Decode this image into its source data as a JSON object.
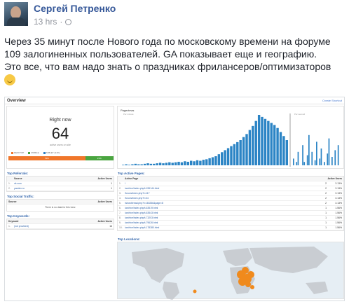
{
  "post": {
    "author": "Сергей Петренко",
    "time": "13 hrs",
    "lines": [
      "Через 35 минут после Нового года по московскому времени на форуме",
      "109 залогиненных пользователей. GA показывает еще и географию.",
      "Это все, что вам надо знать о праздниках фрилансеров/оптимизаторов"
    ]
  },
  "screenshot": {
    "header_title": "Overview",
    "header_link": "Create Shortcut",
    "right_now": {
      "label": "Right now",
      "value": "64",
      "sub": "active users on site",
      "legend": [
        "DESKTOP",
        "MOBILE",
        "TABLET (21%)"
      ],
      "split": [
        {
          "label": "79%",
          "share": 0.73,
          "color": "#f0762a"
        },
        {
          "label": "21%",
          "share": 0.27,
          "color": "#4aa540"
        }
      ]
    },
    "pageviews": {
      "title": "Pageviews",
      "per_minute": "Per minute",
      "per_second": "Per second",
      "per_minute_bars": [
        1,
        2,
        1,
        2,
        3,
        2,
        2,
        3,
        4,
        3,
        3,
        4,
        5,
        4,
        5,
        6,
        5,
        6,
        7,
        6,
        8,
        7,
        9,
        8,
        10,
        9,
        11,
        12,
        14,
        16,
        18,
        22,
        26,
        30,
        34,
        38,
        42,
        46,
        50,
        56,
        62,
        70,
        78,
        88,
        100,
        96,
        92,
        88,
        84,
        80,
        74,
        66,
        58,
        50
      ],
      "per_second_bars": [
        20,
        0,
        10,
        40,
        0,
        0,
        60,
        10,
        0,
        30,
        90,
        0,
        40,
        0,
        15,
        70,
        0,
        20,
        50,
        0,
        10,
        0,
        35,
        80,
        0,
        25,
        0,
        45,
        0,
        60
      ]
    },
    "top_referrals": {
      "title": "Top Referrals:",
      "headers": [
        "Source",
        "Active Users"
      ],
      "rows": [
        [
          "1.",
          "vk.com",
          "1"
        ],
        [
          "2.",
          "yandex.ru",
          "1"
        ]
      ]
    },
    "top_social": {
      "title": "Top Social Traffic:",
      "headers": [
        "Source",
        "Active Users"
      ],
      "empty": "There is no data for this view."
    },
    "top_keywords": {
      "title": "Top Keywords:",
      "headers": [
        "Keyword",
        "Active Users"
      ],
      "rows": [
        [
          "1.",
          "(not provided)",
          "16"
        ]
      ]
    },
    "top_active_pages": {
      "title": "Top Active Pages:",
      "headers": [
        "Active Page",
        "Active Users"
      ],
      "rows": [
        [
          "1.",
          "/",
          "2",
          "3.13%"
        ],
        [
          "2.",
          "/archive/index.php/t-155144.html",
          "2",
          "3.13%"
        ],
        [
          "3.",
          "/forum/index.php?t=117",
          "2",
          "3.13%"
        ],
        [
          "4.",
          "/forum/index.php?f=34",
          "2",
          "3.13%"
        ],
        [
          "5.",
          "/showthread.php?t=163336&page=8",
          "2",
          "3.13%"
        ],
        [
          "6.",
          "/archive/index.php/t-63519.html",
          "1",
          "1.56%"
        ],
        [
          "7.",
          "/archive/index.php/t-63543.html",
          "1",
          "1.56%"
        ],
        [
          "8.",
          "/archive/index.php/t-73203.html",
          "1",
          "1.56%"
        ],
        [
          "9.",
          "/archive/index.php/t-79626.html",
          "1",
          "1.56%"
        ],
        [
          "10.",
          "/archive/index.php/t-178380.html",
          "1",
          "1.56%"
        ]
      ]
    },
    "top_locations": {
      "title": "Top Locations:"
    }
  }
}
